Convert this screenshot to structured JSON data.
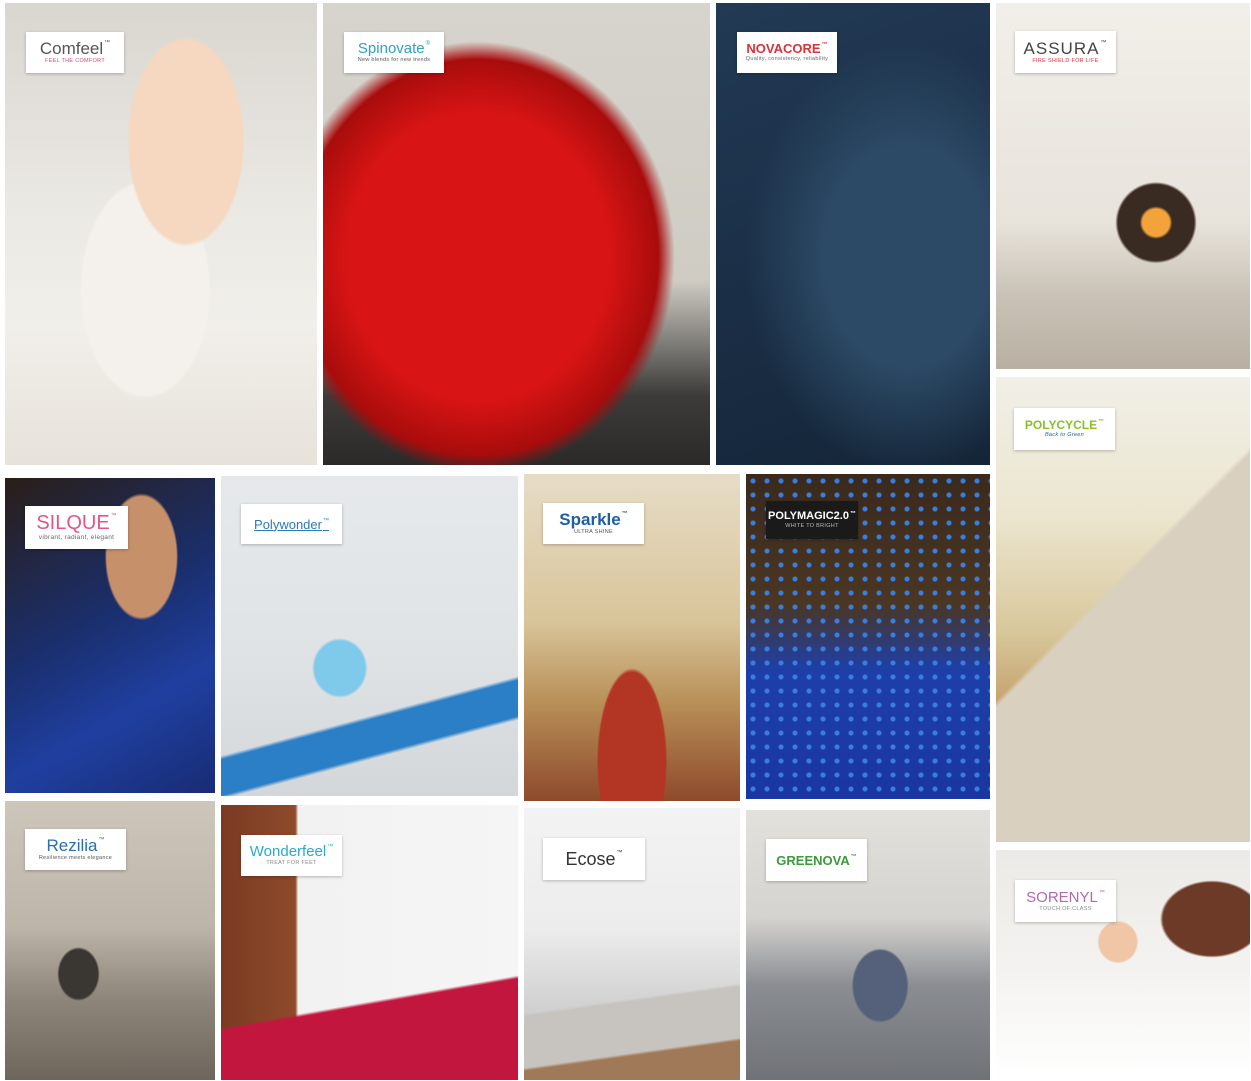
{
  "tiles": {
    "comfeel": {
      "brand": "Comfeel",
      "tagline": "FEEL THE COMFORT",
      "tm": "™"
    },
    "spinovate": {
      "brand": "Spinovate",
      "tagline": "New blends for new trends",
      "tm": "®"
    },
    "novacore": {
      "brand": "NOVACORE",
      "tagline": "Quality, consistency, reliability",
      "tm": "™"
    },
    "assura": {
      "brand": "ASSURA",
      "tagline": "FIRE SHIELD FOR LIFE",
      "tm": "™"
    },
    "polycycle": {
      "brand": "POLYCYCLE",
      "tagline": "Back to Green",
      "tm": "™"
    },
    "silque": {
      "brand": "SILQUE",
      "tagline": "vibrant, radiant, elegant",
      "tm": "™"
    },
    "polywonder": {
      "brand": "Polywonder",
      "tagline": "",
      "tm": "™"
    },
    "sparkle": {
      "brand": "Sparkle",
      "tagline": "ULTRA SHINE",
      "tm": "™"
    },
    "polymagic": {
      "brand": "POLYMAGIC2.0",
      "tagline": "WHITE TO BRIGHT",
      "tm": "™"
    },
    "rezilia": {
      "brand": "Rezilia",
      "tagline": "Resilience meets elegance",
      "tm": "™"
    },
    "wonderfeel": {
      "brand": "Wonderfeel",
      "tagline": "TREAT FOR FEET",
      "tm": "™"
    },
    "ecose": {
      "brand": "Ecose",
      "tagline": "",
      "tm": "™"
    },
    "greenova": {
      "brand": "GREENOVA",
      "tagline": "",
      "tm": "™"
    },
    "sorenyl": {
      "brand": "SORENYL",
      "tagline": "TOUCH OF CLASS",
      "tm": "™"
    }
  },
  "colors": {
    "comfeel": "#555555",
    "comfeel_tag": "#d9487f",
    "spinovate": "#2aa3c4",
    "spinovate_o": "#e23a3a",
    "novacore": "#d8333a",
    "assura": "#444444",
    "assura_u": "#d8333a",
    "polycycle": "#8bbf2a",
    "silque": "#e0568b",
    "polywonder": "#2b79b5",
    "sparkle": "#1d5fa2",
    "polymagic_bg": "#1a1a1a",
    "rezilia": "#2a6fb0",
    "wonderfeel": "#2ba9c8",
    "ecose": "#333333",
    "greenova": "#3a9c3a",
    "greenova_nova": "#1d62a8",
    "sorenyl": "#b06aa8"
  }
}
